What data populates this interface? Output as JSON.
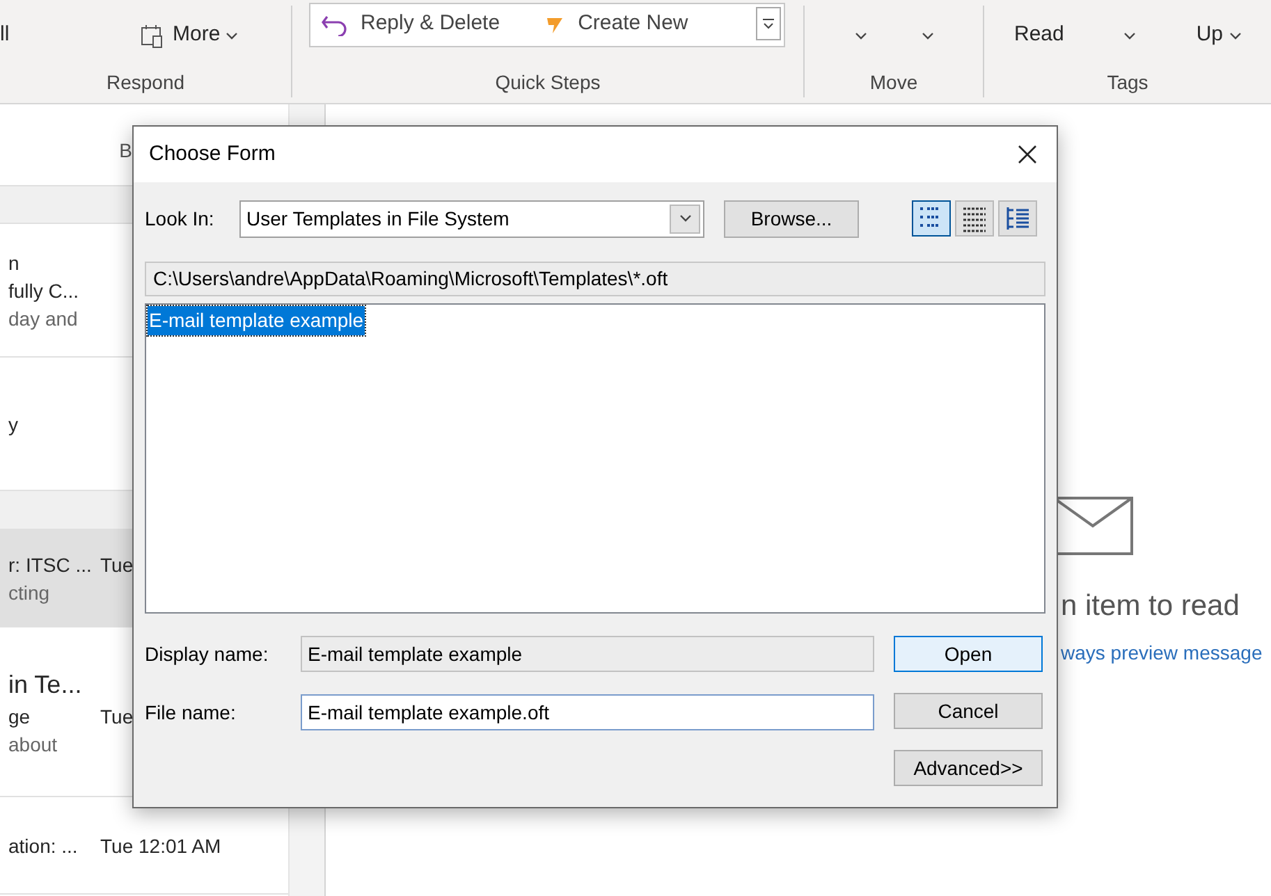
{
  "ribbon": {
    "respond": {
      "buttons": [
        "ll",
        "More"
      ],
      "label": "Respond"
    },
    "quick_steps": {
      "items": [
        "Reply & Delete",
        "Create New"
      ],
      "label": "Quick Steps"
    },
    "move": {
      "label": "Move"
    },
    "tags": {
      "buttons": [
        "Read",
        "Up"
      ],
      "label": "Tags"
    }
  },
  "message_list": {
    "header": "B",
    "items": [
      {
        "lines": [
          "n",
          "fully C...",
          "day and"
        ],
        "selected": false
      },
      {
        "lines": [
          "y"
        ],
        "selected": false
      },
      {
        "lines": [
          "r: ITSC ...",
          "cting"
        ],
        "date": "Tue",
        "selected": true
      },
      {
        "lines": [
          "in Te...",
          "ge",
          "about"
        ],
        "date": "Tue",
        "selected": false
      },
      {
        "lines": [
          "ation: ..."
        ],
        "date": "Tue 12:01 AM",
        "selected": false
      }
    ]
  },
  "reading_pane": {
    "message": "n item to read",
    "link": "ways preview message"
  },
  "dialog": {
    "title": "Choose Form",
    "look_in_label": "Look In:",
    "look_in_value": "User Templates in File System",
    "browse": "Browse...",
    "views": [
      {
        "selected": true
      },
      {
        "selected": false
      },
      {
        "selected": false
      }
    ],
    "path": "C:\\Users\\andre\\AppData\\Roaming\\Microsoft\\Templates\\*.oft",
    "files": [
      {
        "name": "E-mail template example",
        "selected": true
      }
    ],
    "display_name_label": "Display name:",
    "display_name": "E-mail template example",
    "file_name_label": "File name:",
    "file_name": "E-mail template example.oft",
    "buttons": [
      "Open",
      "Cancel",
      "Advanced>>"
    ]
  }
}
